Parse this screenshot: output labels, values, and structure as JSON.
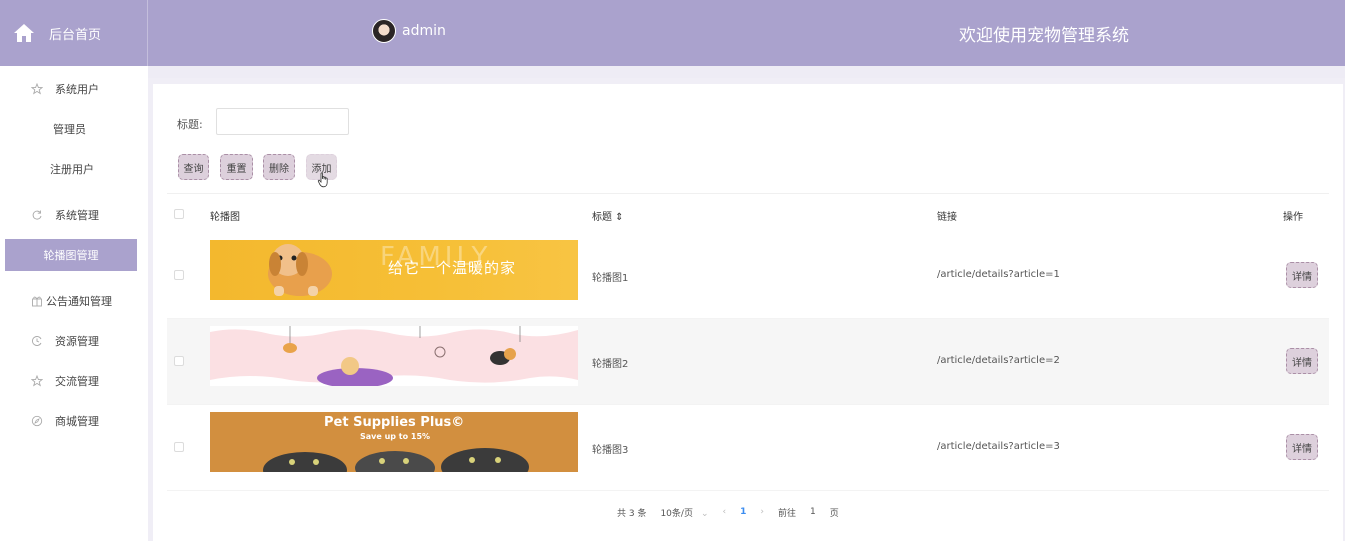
{
  "header": {
    "home_label": "后台首页",
    "user_name": "admin",
    "welcome": "欢迎使用宠物管理系统"
  },
  "sidebar": {
    "items": [
      {
        "label": "系统用户",
        "icon": "star-icon"
      },
      {
        "label": "管理员"
      },
      {
        "label": "注册用户"
      },
      {
        "label": "系统管理",
        "icon": "refresh-icon"
      },
      {
        "label": "轮播图管理"
      },
      {
        "label": "公告通知管理",
        "icon": "gift-icon"
      },
      {
        "label": "资源管理",
        "icon": "clock-icon"
      },
      {
        "label": "交流管理",
        "icon": "star-icon"
      },
      {
        "label": "商城管理",
        "icon": "compass-icon"
      }
    ]
  },
  "search": {
    "title_label": "标题:",
    "title_value": ""
  },
  "toolbar": {
    "query": "查询",
    "reset": "重置",
    "delete": "删除",
    "add": "添加"
  },
  "table": {
    "headers": {
      "image": "轮播图",
      "title": "标题 ⇕",
      "link": "链接",
      "action": "操作"
    },
    "rows": [
      {
        "title": "轮播图1",
        "link": "/article/details?article=1",
        "action": "详情",
        "banner_big": "FAMILY",
        "banner_text": "给它一个温暖的家"
      },
      {
        "title": "轮播图2",
        "link": "/article/details?article=2",
        "action": "详情"
      },
      {
        "title": "轮播图3",
        "link": "/article/details?article=3",
        "action": "详情",
        "banner_text": "Pet Supplies Plus©",
        "banner_sub": "Save up to 15%"
      }
    ]
  },
  "pagination": {
    "total": "共 3 条",
    "page_size": "10条/页",
    "current_page": "1",
    "goto_label": "前往",
    "goto_value": "1",
    "page_unit": "页"
  },
  "colors": {
    "primary": "#aaa2cd",
    "button_bg": "#ddd0dc",
    "page_active": "#3b8cf0"
  }
}
